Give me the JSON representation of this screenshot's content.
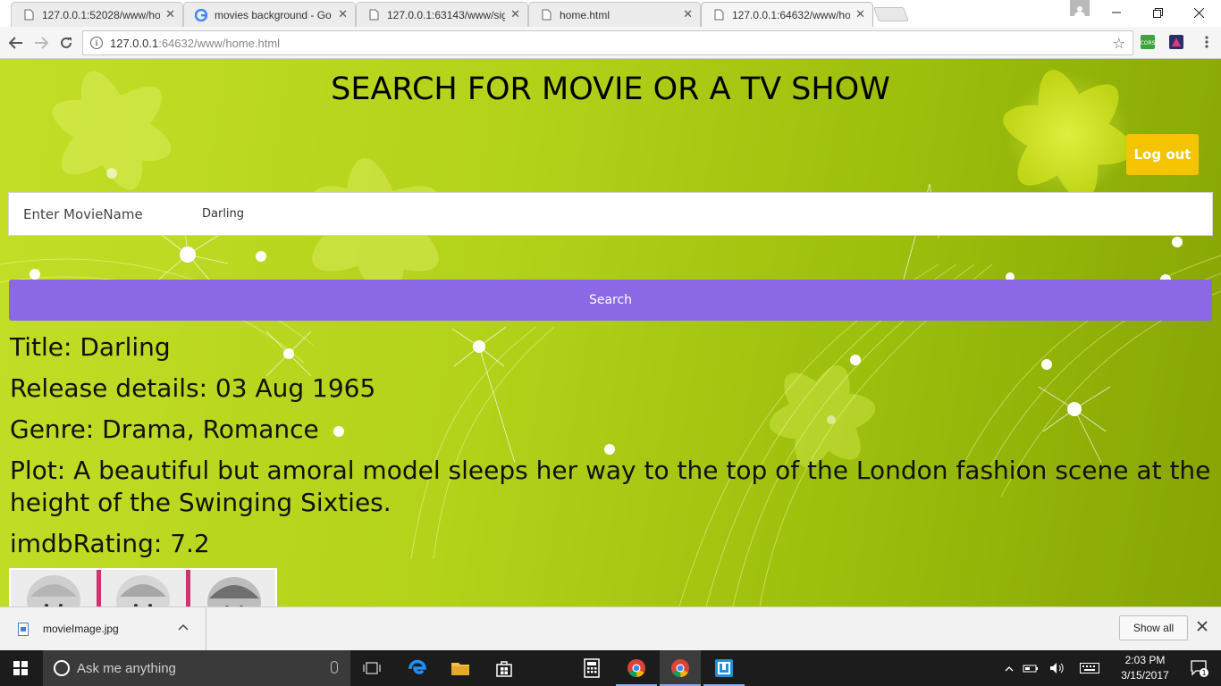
{
  "browser": {
    "tabs": [
      {
        "title": "127.0.0.1:52028/www/ho"
      },
      {
        "title": "movies background - Go"
      },
      {
        "title": "127.0.0.1:63143/www/sig"
      },
      {
        "title": "home.html"
      },
      {
        "title": "127.0.0.1:64632/www/ho"
      }
    ],
    "active_tab_index": 4,
    "url_host": "127.0.0.1",
    "url_rest": ":64632/www/home.html"
  },
  "page": {
    "heading": "SEARCH FOR MOVIE OR A TV SHOW",
    "logout_label": "Log out",
    "search_label": "Enter MovieName",
    "search_value": "Darling",
    "search_button": "Search",
    "result": {
      "title": "Title: Darling",
      "release": "Release details: 03 Aug 1965",
      "genre": "Genre: Drama, Romance",
      "plot": "Plot: A beautiful but amoral model sleeps her way to the top of the London fashion scene at the height of the Swinging Sixties.",
      "rating": "imdbRating: 7.2"
    }
  },
  "downloads": {
    "file_name": "movieImage.jpg",
    "show_all": "Show all"
  },
  "taskbar": {
    "search_placeholder": "Ask me anything",
    "time": "2:03 PM",
    "date": "3/15/2017",
    "notification_count": "1"
  },
  "colors": {
    "background_green": "#b3d21a",
    "logout_yellow": "#f5c400",
    "search_button_purple": "#8a68e6"
  }
}
